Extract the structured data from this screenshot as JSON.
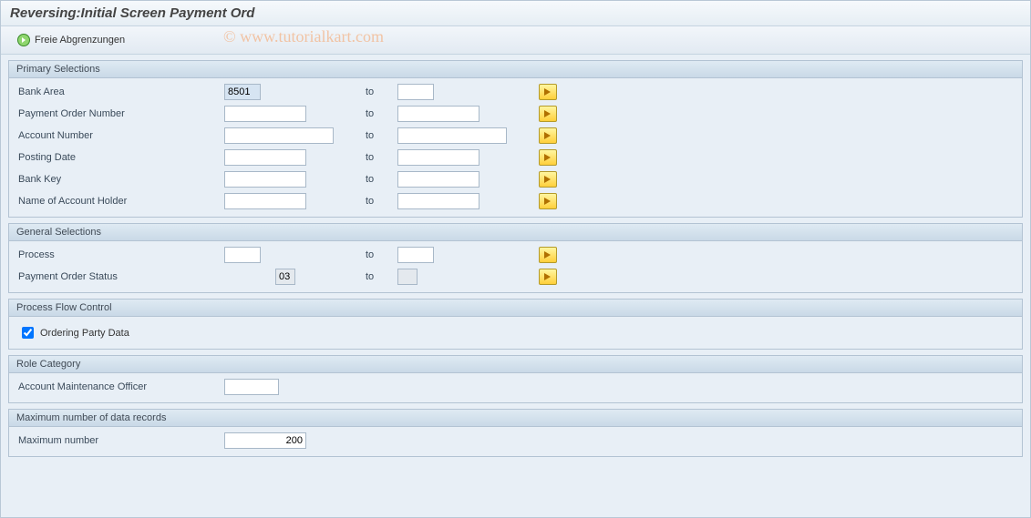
{
  "header": {
    "title": "Reversing:Initial Screen Payment Ord"
  },
  "toolbar": {
    "freie_label": "Freie Abgrenzungen"
  },
  "watermark": "© www.tutorialkart.com",
  "groups": {
    "primary": {
      "title": "Primary Selections",
      "to_label": "to",
      "rows": {
        "bank_area": {
          "label": "Bank Area",
          "from": "8501",
          "to": ""
        },
        "po_number": {
          "label": "Payment Order Number",
          "from": "",
          "to": ""
        },
        "account_no": {
          "label": "Account Number",
          "from": "",
          "to": ""
        },
        "posting_date": {
          "label": "Posting Date",
          "from": "",
          "to": ""
        },
        "bank_key": {
          "label": "Bank Key",
          "from": "",
          "to": ""
        },
        "holder": {
          "label": "Name of Account Holder",
          "from": "",
          "to": ""
        }
      }
    },
    "general": {
      "title": "General Selections",
      "to_label": "to",
      "rows": {
        "process": {
          "label": "Process",
          "from": "",
          "to": ""
        },
        "po_status": {
          "label": "Payment Order Status",
          "from": "03",
          "to": ""
        }
      }
    },
    "flow": {
      "title": "Process Flow Control",
      "ordering_label": "Ordering Party Data",
      "ordering_checked": true
    },
    "role": {
      "title": "Role Category",
      "officer_label": "Account Maintenance Officer",
      "officer_value": ""
    },
    "max": {
      "title": "Maximum number of data records",
      "max_label": "Maximum number",
      "max_value": "200"
    }
  }
}
